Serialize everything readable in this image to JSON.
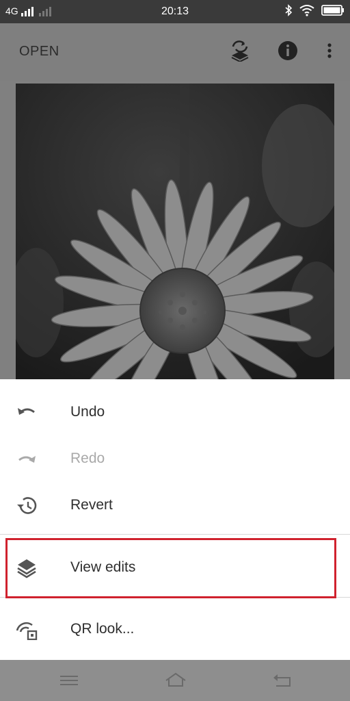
{
  "status_bar": {
    "network": "4G",
    "time": "20:13"
  },
  "app_bar": {
    "open_label": "OPEN",
    "icons": [
      "layers-refresh-icon",
      "info-icon",
      "more-vert-icon"
    ]
  },
  "menu": {
    "items": [
      {
        "label": "Undo",
        "icon": "undo-icon",
        "enabled": true
      },
      {
        "label": "Redo",
        "icon": "redo-icon",
        "enabled": false
      },
      {
        "label": "Revert",
        "icon": "history-icon",
        "enabled": true
      },
      {
        "label": "View edits",
        "icon": "layers-icon",
        "enabled": true,
        "highlighted": true
      },
      {
        "label": "QR look...",
        "icon": "qr-look-icon",
        "enabled": true
      }
    ]
  },
  "nav_bar": {
    "icons": [
      "menu-icon",
      "home-icon",
      "back-icon"
    ]
  },
  "colors": {
    "highlight": "#d0222e",
    "disabled_text": "#a9a9a9"
  }
}
